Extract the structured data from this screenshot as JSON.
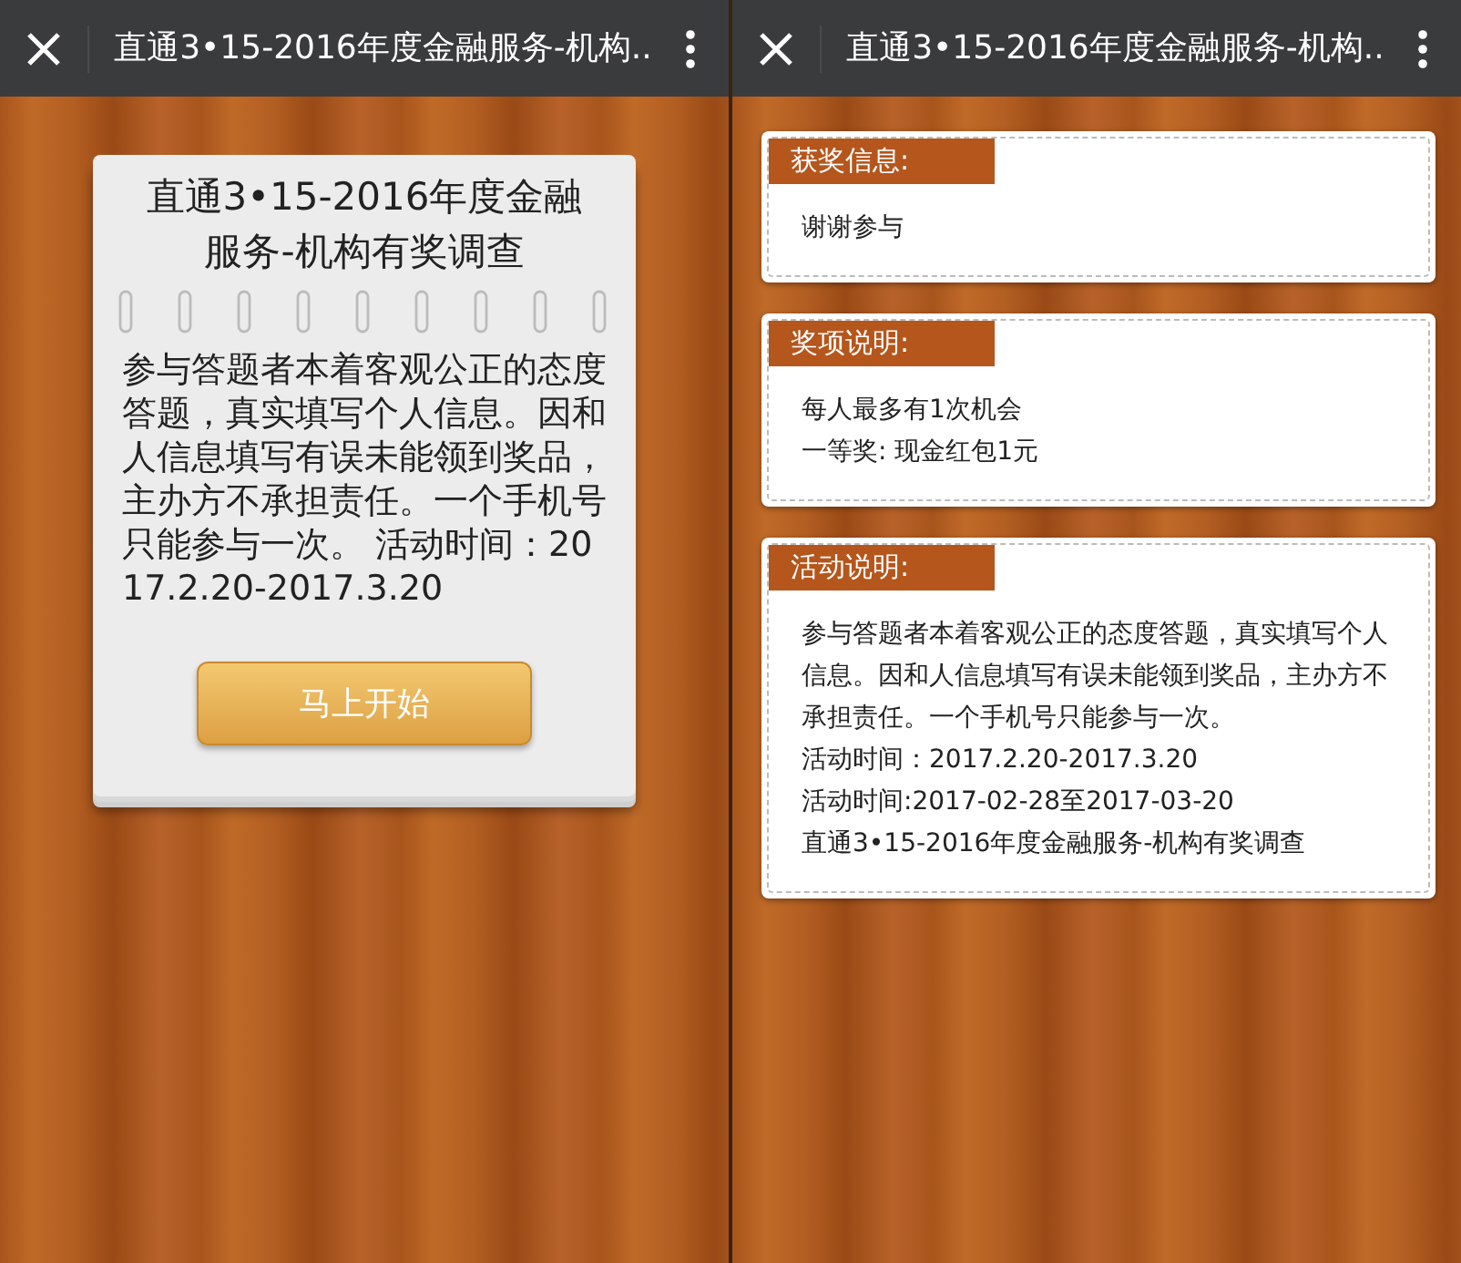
{
  "left_screen": {
    "header": {
      "title": "直通3•15-2016年度金融服务-机构.."
    },
    "card": {
      "title": "直通3•15-2016年度金融服务-机构有奖调查",
      "body": "参与答题者本着客观公正的态度答题，真实填写个人信息。因和人信息填写有误未能领到奖品，主办方不承担责任。一个手机号只能参与一次。 活动时间：2017.2.20-2017.3.20",
      "button": "马上开始"
    }
  },
  "right_screen": {
    "header": {
      "title": "直通3•15-2016年度金融服务-机构.."
    },
    "sections": [
      {
        "label": "获奖信息:",
        "lines": [
          "谢谢参与"
        ]
      },
      {
        "label": "奖项说明:",
        "lines": [
          "每人最多有1次机会",
          "一等奖: 现金红包1元"
        ]
      },
      {
        "label": "活动说明:",
        "lines": [
          "参与答题者本着客观公正的态度答题，真实填写个人信息。因和人信息填写有误未能领到奖品，主办方不承担责任。一个手机号只能参与一次。",
          "活动时间：2017.2.20-2017.3.20",
          "活动时间:2017-02-28至2017-03-20",
          "直通3•15-2016年度金融服务-机构有奖调查"
        ]
      }
    ]
  }
}
